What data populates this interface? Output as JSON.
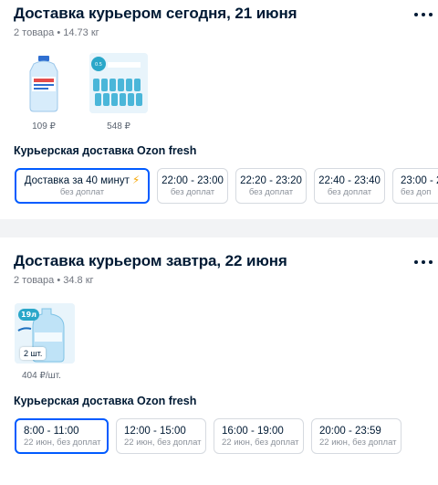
{
  "section1": {
    "title": "Доставка курьером сегодня, 21 июня",
    "meta": "2 товара • 14.73 кг",
    "items": [
      {
        "price": "109 ₽",
        "icon": "water-bottle-5l"
      },
      {
        "price": "548 ₽",
        "icon": "water-bottle-pack"
      }
    ],
    "delivery_label": "Курьерская доставка Ozon fresh",
    "slots": [
      {
        "time": "Доставка за 40 минут",
        "sub": "без доплат",
        "icon": "lightning-icon",
        "selected": true
      },
      {
        "time": "22:00 - 23:00",
        "sub": "без доплат",
        "selected": false
      },
      {
        "time": "22:20 - 23:20",
        "sub": "без доплат",
        "selected": false
      },
      {
        "time": "22:40 - 23:40",
        "sub": "без доплат",
        "selected": false
      },
      {
        "time": "23:00 - 2",
        "sub": "без доп",
        "selected": false
      }
    ]
  },
  "section2": {
    "title": "Доставка курьером завтра, 22 июня",
    "meta": "2 товара • 34.8 кг",
    "items": [
      {
        "price": "404 ₽/шт.",
        "qty": "2 шт.",
        "badge": "19л",
        "icon": "water-cooler-bottle"
      }
    ],
    "delivery_label": "Курьерская доставка Ozon fresh",
    "slots": [
      {
        "time": "8:00 - 11:00",
        "sub": "22 июн, без доплат",
        "selected": true
      },
      {
        "time": "12:00 - 15:00",
        "sub": "22 июн, без доплат",
        "selected": false
      },
      {
        "time": "16:00 - 19:00",
        "sub": "22 июн, без доплат",
        "selected": false
      },
      {
        "time": "20:00 - 23:59",
        "sub": "22 июн, без доплат",
        "selected": false
      }
    ]
  },
  "colors": {
    "accent": "#005bff",
    "text": "#001a34",
    "muted": "#70757f",
    "bolt": "#f7a600"
  }
}
